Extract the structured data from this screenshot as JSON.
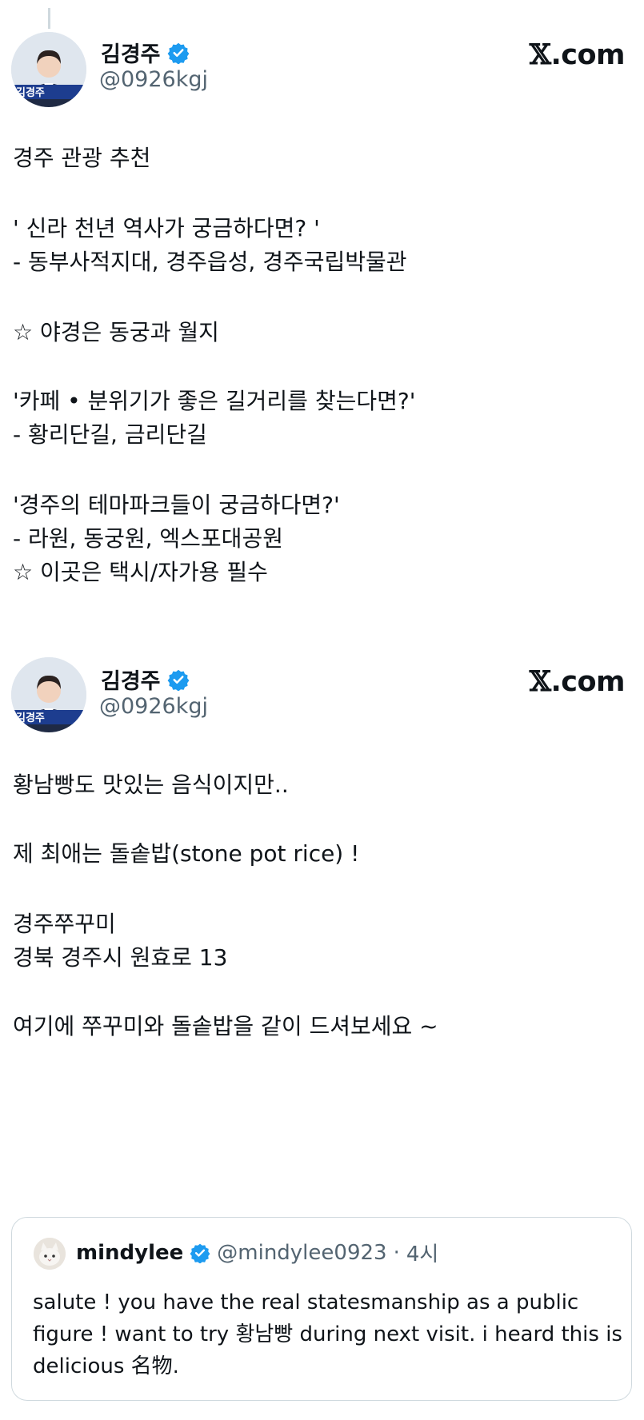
{
  "posts": [
    {
      "author": {
        "name": "김경주",
        "handle": "@0926kgj",
        "avatar_badge": "김경주"
      },
      "source_label": "com",
      "lines": [
        "경주 관광 추천",
        "' 신라 천년 역사가 궁금하다면? '",
        "- 동부사적지대, 경주읍성, 경주국립박물관",
        "☆ 야경은 동궁과 월지",
        "'카페 • 분위기가 좋은 길거리를 찾는다면?'",
        "- 황리단길, 금리단길",
        "'경주의 테마파크들이 궁금하다면?'",
        "- 라원, 동궁원, 엑스포대공원",
        "☆ 이곳은 택시/자가용 필수"
      ]
    },
    {
      "author": {
        "name": "김경주",
        "handle": "@0926kgj",
        "avatar_badge": "김경주"
      },
      "source_label": "com",
      "lines": [
        "황남빵도 맛있는 음식이지만..",
        "제 최애는 돌솥밥(stone pot rice) !",
        "경주쭈꾸미",
        "경북 경주시 원효로 13",
        "여기에 쭈꾸미와 돌솥밥을 같이 드셔보세요 ~"
      ]
    }
  ],
  "quote": {
    "name": "mindylee",
    "handle": "@mindylee0923",
    "separator": "·",
    "time": "4시",
    "text": "salute ! you have the real statesmanship as a public figure ! want to try 황남빵 during next visit. i heard this is delicious 名物."
  },
  "icons": {
    "verified": "verified-badge-icon",
    "x_logo": "x-logo-icon"
  },
  "colors": {
    "verified": "#1d9bf0",
    "muted": "#536471",
    "text": "#0f1419",
    "border": "#cfd9de"
  }
}
